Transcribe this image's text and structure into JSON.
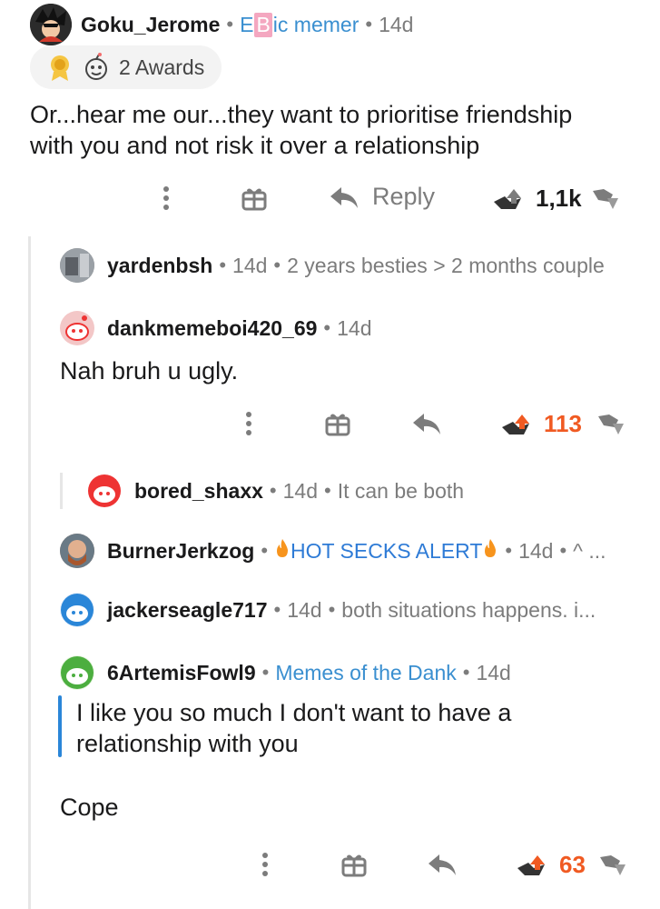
{
  "thread": [
    {
      "user": "Goku_Jerome",
      "flair": "Epic memer",
      "flair_parts": [
        "E",
        "B",
        "ic memer"
      ],
      "time": "14d",
      "awards_label": "2 Awards",
      "body_lines": [
        "Or...hear me our...they want to prioritise friendship",
        "with you and not risk it over a relationship"
      ],
      "actions": {
        "reply_label": "Reply",
        "votes": "1,1k"
      }
    },
    {
      "user": "yardenbsh",
      "time": "14d",
      "preview": "2 years besties > 2 months couple",
      "collapsed": true
    },
    {
      "user": "dankmemeboi420_69",
      "time": "14d",
      "body_lines": [
        "Nah bruh u ugly."
      ],
      "actions": {
        "votes": "113"
      }
    },
    {
      "user": "bored_shaxx",
      "time": "14d",
      "preview": "It can be both",
      "collapsed": true
    },
    {
      "user": "BurnerJerkzog",
      "flair": "HOT SECKS ALERT",
      "time": "14d",
      "preview": "^ ...",
      "collapsed": true
    },
    {
      "user": "jackerseagle717",
      "time": "14d",
      "preview": "both situations happens. i...",
      "collapsed": true
    },
    {
      "user": "6ArtemisFowl9",
      "flair": "Memes of the Dank",
      "time": "14d",
      "quote_lines": [
        "I like you so much I don't want to have a",
        "relationship with you"
      ],
      "body_lines": [
        "Cope"
      ],
      "actions": {
        "votes": "63"
      }
    }
  ],
  "colors": {
    "upvoted": "#f05a22",
    "flair": "#3a8fd0",
    "quote_bar": "#2a86d8",
    "meta": "#7c7c7c"
  },
  "icons": [
    "more-options-icon",
    "gift-icon",
    "reply-arrow-icon",
    "upvote-icon",
    "downvote-icon",
    "fire-icon"
  ]
}
